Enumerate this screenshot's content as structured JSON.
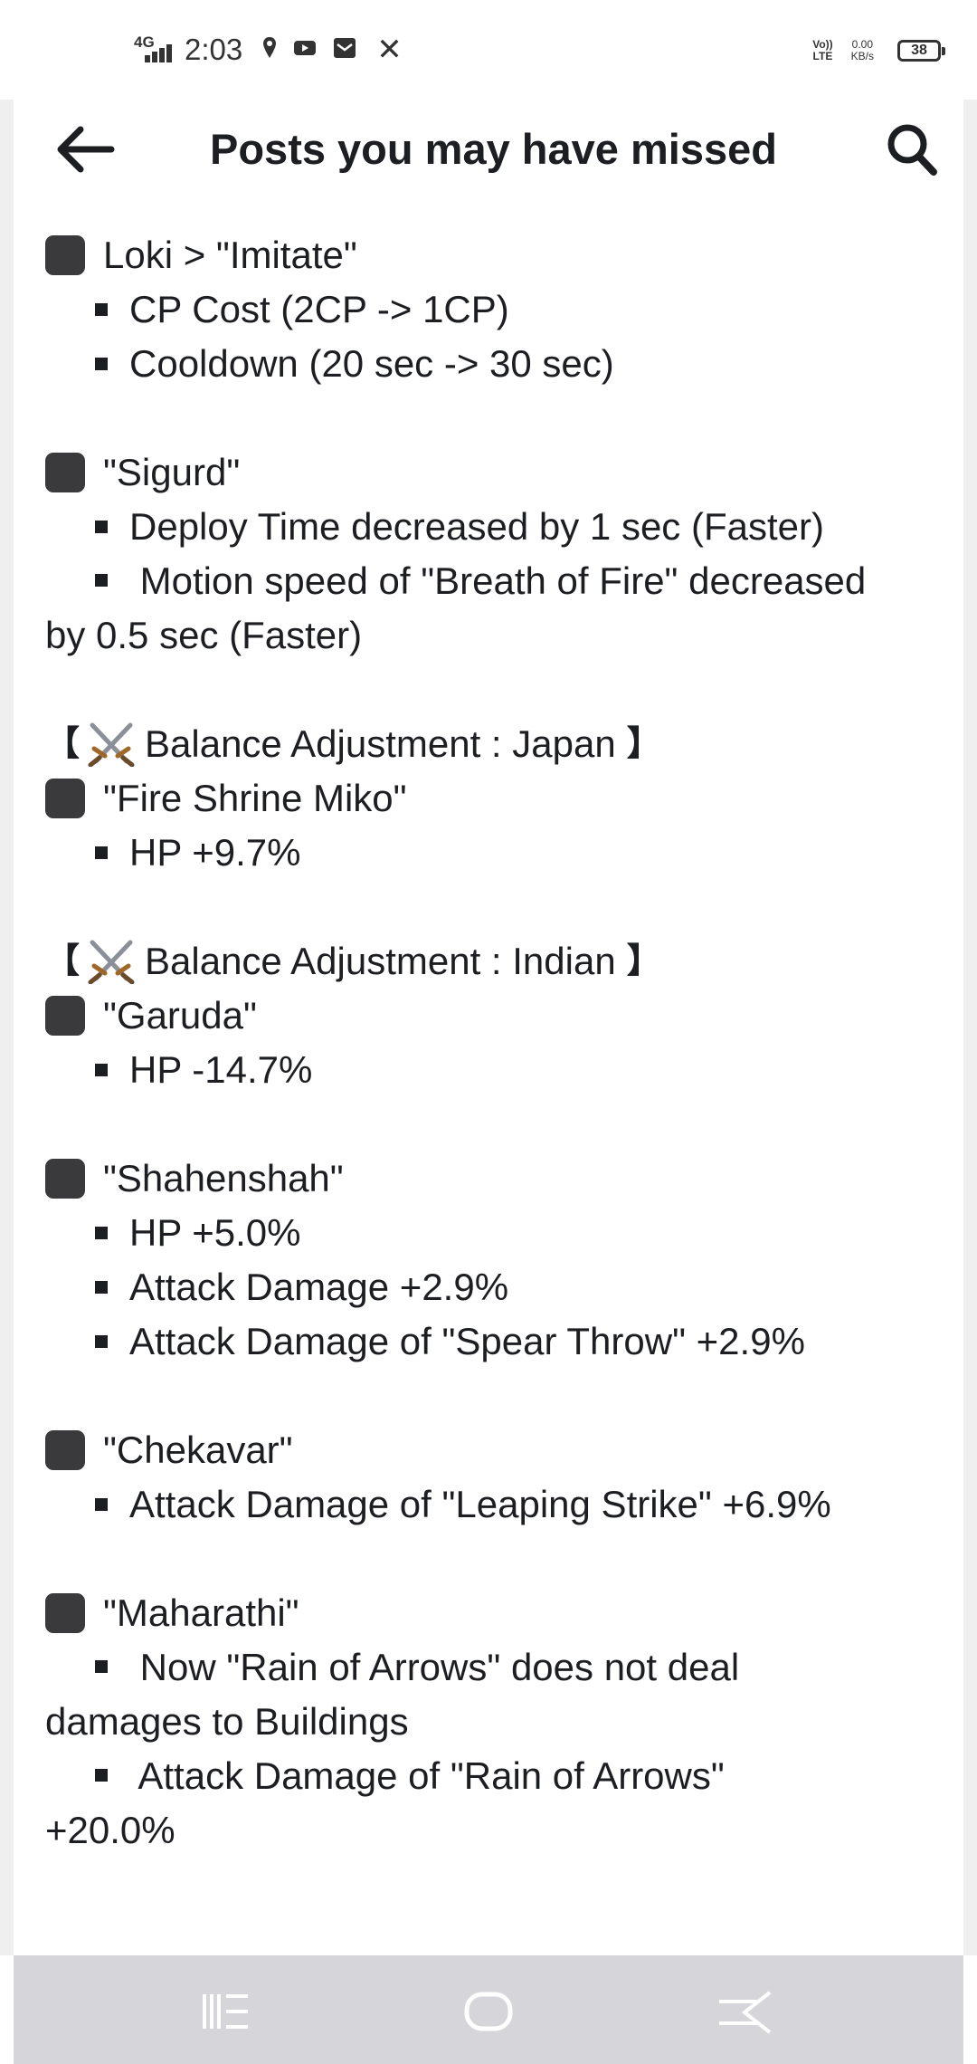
{
  "status_bar": {
    "network": "4G",
    "time": "2:03",
    "volte_top": "Vo))",
    "volte_bottom": "LTE",
    "speed_value": "0.00",
    "speed_unit": "KB/s",
    "battery": "38",
    "icons": [
      "location-icon",
      "youtube-icon",
      "mail-icon",
      "x-icon"
    ]
  },
  "header": {
    "title": "Posts you may have missed",
    "back_icon": "arrow-left-icon",
    "search_icon": "search-icon"
  },
  "post": {
    "loki": {
      "name": "Loki > \"Imitate\"",
      "items": [
        "CP Cost (2CP -> 1CP)",
        "Cooldown (20 sec -> 30 sec)"
      ]
    },
    "sigurd": {
      "name": "\"Sigurd\"",
      "items": [
        "Deploy Time decreased by 1 sec (Faster)",
        "Motion speed of \"Breath of Fire\" decreased by 0.5 sec (Faster)"
      ]
    },
    "japan": {
      "bracket_open": "【",
      "bracket_close": "】",
      "heading": "Balance Adjustment : Japan",
      "name": "\"Fire Shrine Miko\"",
      "items": [
        "HP +9.7%"
      ]
    },
    "indian": {
      "bracket_open": "【",
      "bracket_close": "】",
      "heading": "Balance Adjustment : Indian",
      "garuda": {
        "name": "\"Garuda\"",
        "items": [
          "HP -14.7%"
        ]
      },
      "shahenshah": {
        "name": "\"Shahenshah\"",
        "items": [
          "HP +5.0%",
          "Attack Damage +2.9%",
          "Attack Damage of \"Spear Throw\" +2.9%"
        ]
      },
      "chekavar": {
        "name": "\"Chekavar\"",
        "items": [
          "Attack Damage of \"Leaping Strike\" +6.9%"
        ]
      },
      "maharathi": {
        "name": "\"Maharathi\"",
        "items": [
          "Now \"Rain of Arrows\" does not deal damages to Buildings",
          "Attack Damage of \"Rain of Arrows\" +20.0%"
        ]
      }
    }
  },
  "nav_bar": {
    "recents_icon": "recents-icon",
    "home_icon": "home-icon",
    "back_icon": "back-gesture-icon"
  },
  "colors": {
    "text": "#1c1e21",
    "nav_bg": "#d6d6da",
    "bullet_box": "#3a3a3c"
  }
}
